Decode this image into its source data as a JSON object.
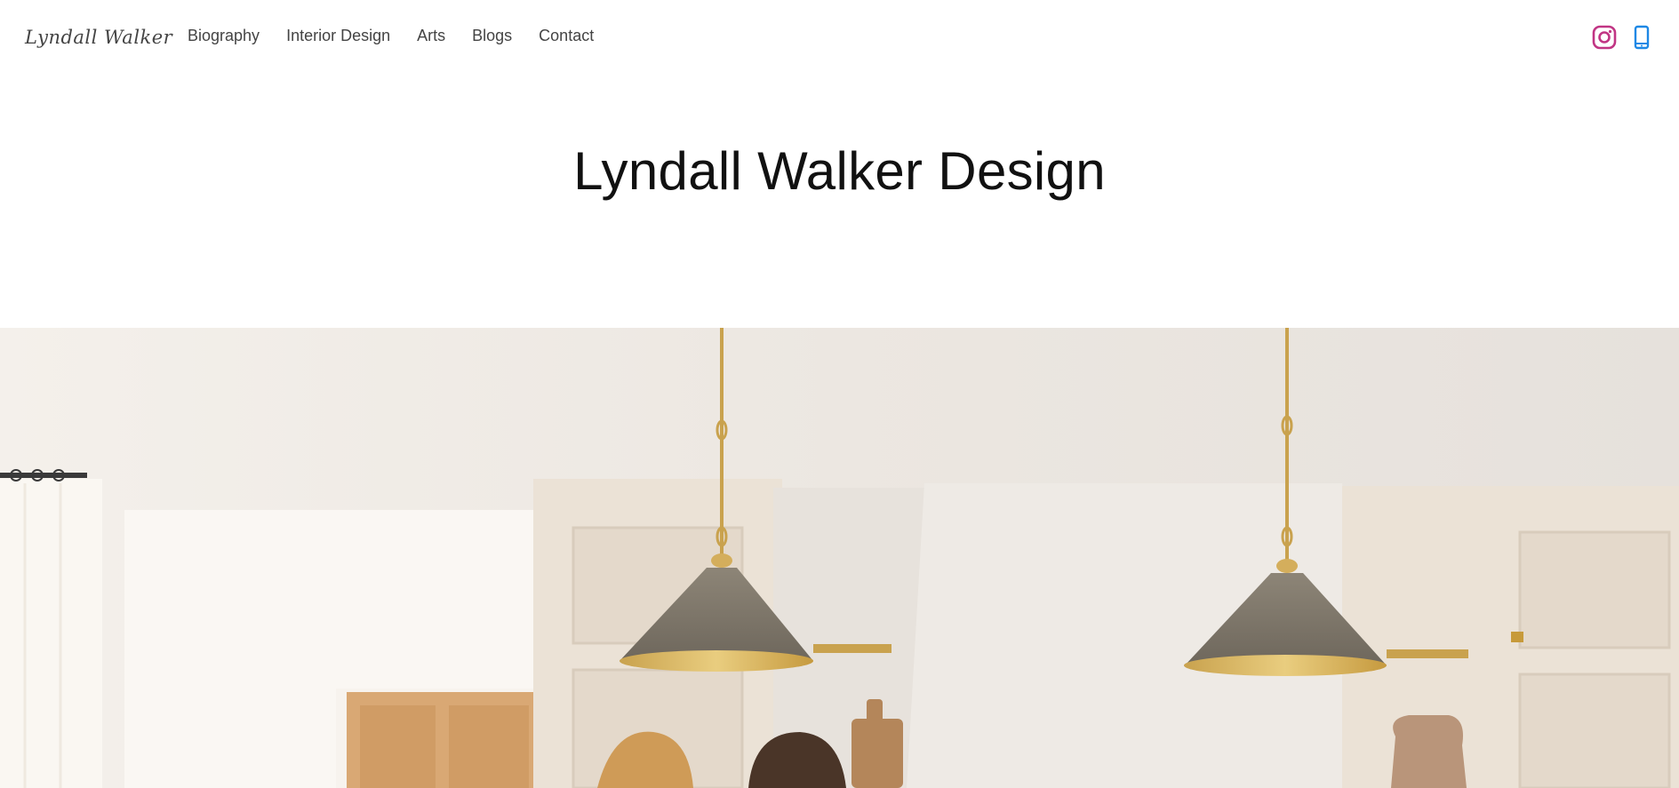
{
  "header": {
    "logo_text": "Lyndall Walker",
    "nav": [
      {
        "label": "Biography"
      },
      {
        "label": "Interior Design"
      },
      {
        "label": "Arts"
      },
      {
        "label": "Blogs"
      },
      {
        "label": "Contact"
      }
    ],
    "social": [
      {
        "icon": "instagram-icon",
        "color": "#c13584"
      },
      {
        "icon": "phone-icon",
        "color": "#1e88e5"
      }
    ]
  },
  "main": {
    "title": "Lyndall Walker Design"
  },
  "hero": {
    "icon": "kitchen-photo"
  }
}
